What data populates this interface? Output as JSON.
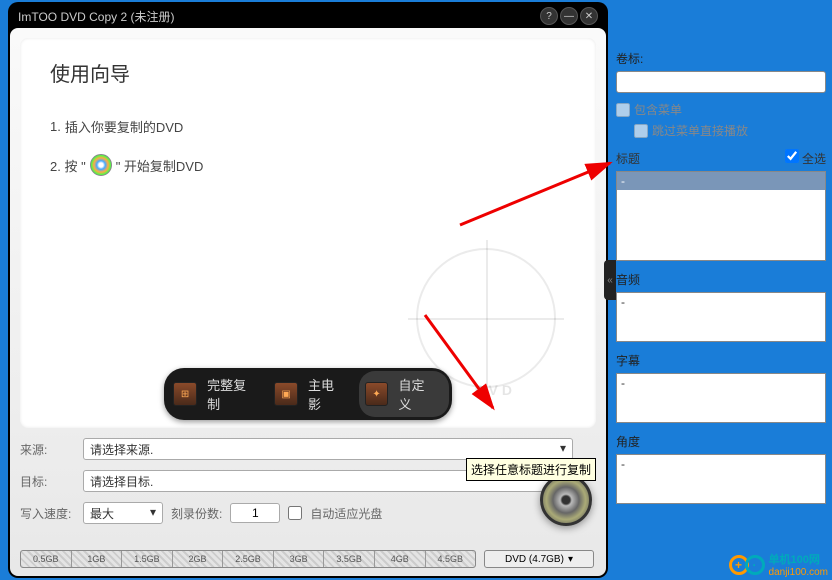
{
  "titlebar": {
    "title": "ImTOO DVD Copy 2 (未注册)"
  },
  "wizard": {
    "heading": "使用向导",
    "step1_prefix": "1. ",
    "step1_text": "插入你要复制的DVD",
    "step2_prefix": "2. 按 \"",
    "step2_suffix": "\" 开始复制DVD",
    "bg_label": "DVD"
  },
  "tabs": {
    "full": "完整复制",
    "main": "主电影",
    "custom": "自定义"
  },
  "tooltip": "选择任意标题进行复制",
  "form": {
    "source_label": "来源:",
    "source_value": "请选择来源.",
    "target_label": "目标:",
    "target_value": "请选择目标.",
    "speed_label": "写入速度:",
    "speed_value": "最大",
    "copies_label": "刻录份数:",
    "copies_value": "1",
    "autofit_label": "自动适应光盘"
  },
  "sizebar": [
    "0.5GB",
    "1GB",
    "1.5GB",
    "2GB",
    "2.5GB",
    "3GB",
    "3.5GB",
    "4GB",
    "4.5GB"
  ],
  "capacity": "DVD (4.7GB)",
  "side": {
    "volume_label": "卷标:",
    "volume_value": "",
    "include_menu": "包含菜单",
    "skip_menu": "跳过菜单直接播放",
    "title_label": "标题",
    "select_all": "全选",
    "title_item": "-",
    "audio_label": "音频",
    "audio_item": "-",
    "subtitle_label": "字幕",
    "subtitle_item": "-",
    "angle_label": "角度",
    "angle_item": "-"
  },
  "logo": {
    "brand": "单机100网",
    "url": "danji100.com"
  }
}
